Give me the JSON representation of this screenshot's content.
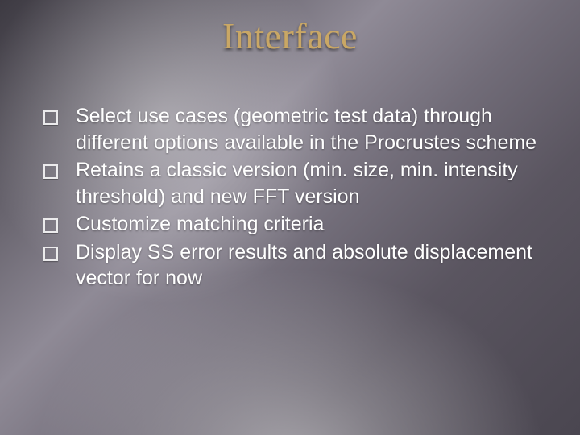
{
  "slide": {
    "title": "Interface",
    "bullets": [
      "Select use cases (geometric test data) through different options available in the Procrustes scheme",
      "Retains a classic version (min. size, min. intensity threshold) and new FFT version",
      "Customize matching criteria",
      "Display SS error results and absolute displacement vector for now"
    ]
  }
}
